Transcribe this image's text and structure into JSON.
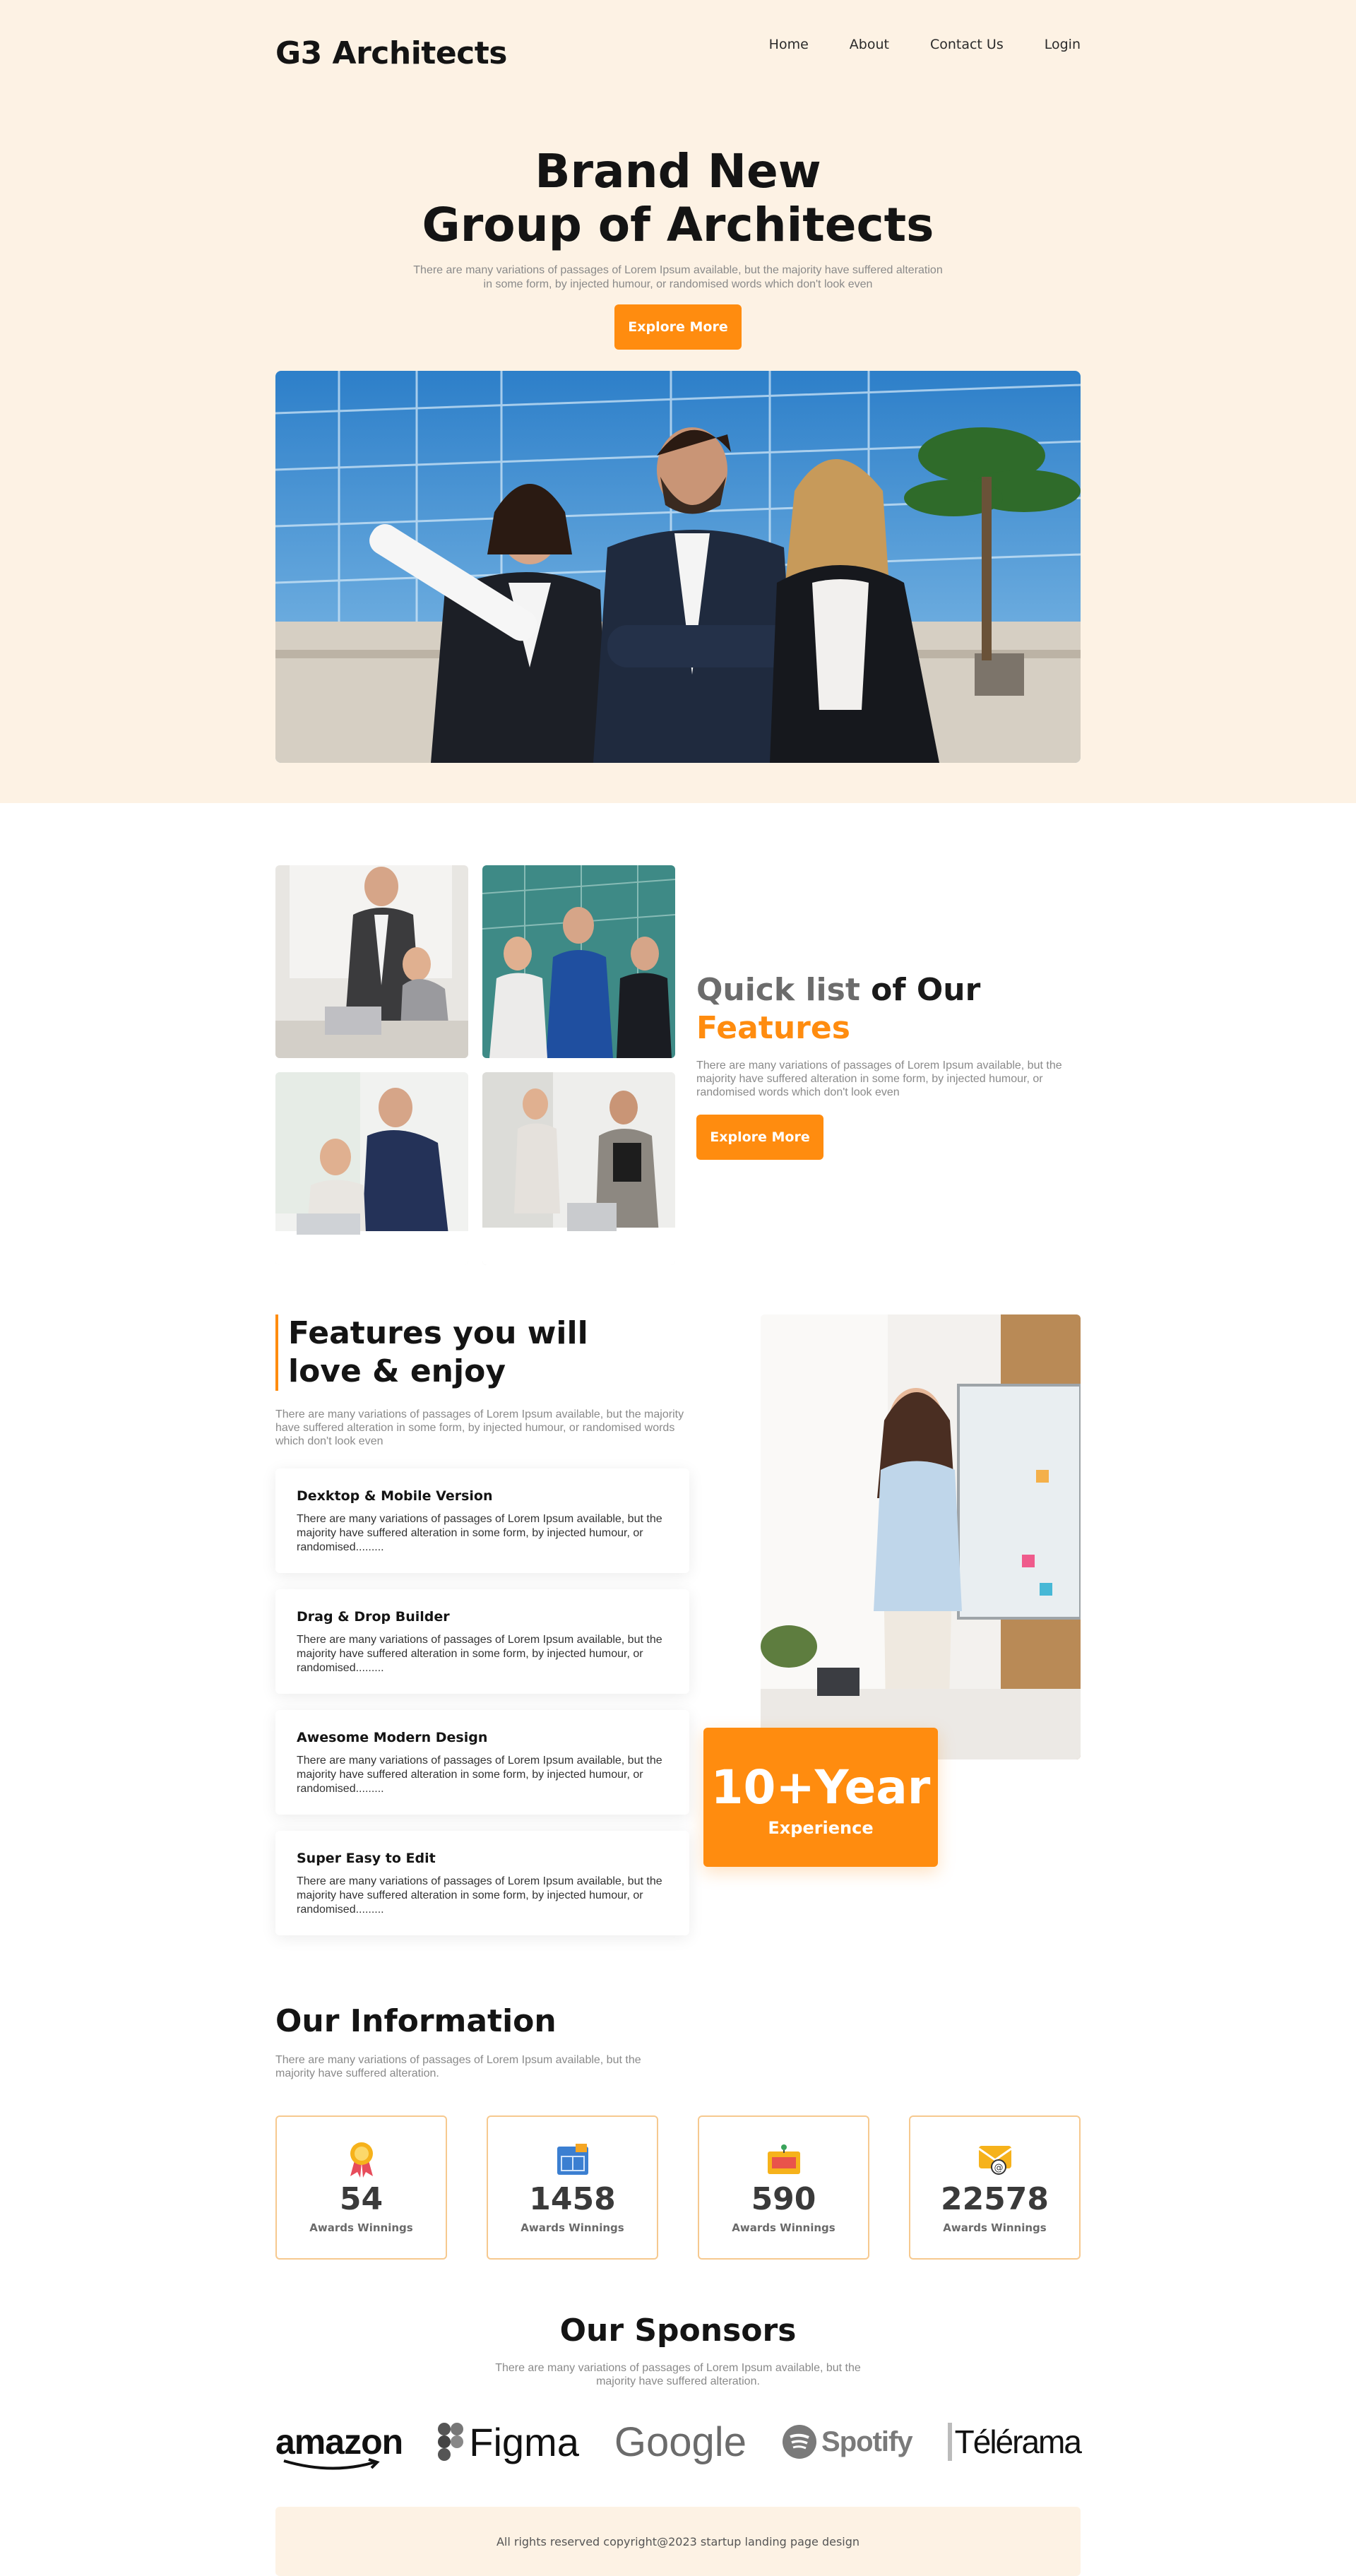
{
  "nav": {
    "logo": "G3 Architects",
    "items": [
      "Home",
      "About",
      "Contact Us",
      "Login"
    ]
  },
  "hero": {
    "title_line1": "Brand New",
    "title_line2": "Group of Architects",
    "subtitle": "There are many variations of passages of Lorem Ipsum available, but the majority have suffered alteration in some form, by injected humour, or randomised words which don't look even",
    "button": "Explore More"
  },
  "quick": {
    "title_gray": "Quick list",
    "title_dark": " of Our",
    "title_orange": "Features",
    "subtitle": "There are many variations of passages of Lorem Ipsum available, but the majority have suffered alteration in some form, by injected humour, or randomised words which don't look even",
    "button": "Explore More"
  },
  "features": {
    "title_line1": "Features you will",
    "title_line2": "love & enjoy",
    "subtitle": "There are many variations of passages of Lorem Ipsum available, but the majority have suffered alteration in some form, by injected humour, or randomised words which don't look even",
    "cards": [
      {
        "title": "Dexktop & Mobile Version",
        "text": "There are many variations of passages of Lorem Ipsum available, but the majority have suffered alteration in some form, by injected humour, or randomised........."
      },
      {
        "title": "Drag & Drop Builder",
        "text": "There are many variations of passages of Lorem Ipsum available, but the majority have suffered alteration in some form, by injected humour, or randomised........."
      },
      {
        "title": "Awesome Modern Design",
        "text": "There are many variations of passages of Lorem Ipsum available, but the majority have suffered alteration in some form, by injected humour, or randomised........."
      },
      {
        "title": "Super Easy to Edit",
        "text": "There are many variations of passages of Lorem Ipsum available, but the majority have suffered alteration in some form, by injected humour, or randomised........."
      }
    ],
    "experience_big": "10+Year",
    "experience_small": "Experience"
  },
  "info": {
    "title": "Our Information",
    "subtitle": "There are many variations of passages of Lorem Ipsum available, but the majority have suffered alteration.",
    "stats": [
      {
        "icon": "award-ribbon-icon",
        "value": "54",
        "label": "Awards Winnings"
      },
      {
        "icon": "blueprint-icon",
        "value": "1458",
        "label": "Awards Winnings"
      },
      {
        "icon": "certificate-icon",
        "value": "590",
        "label": "Awards Winnings"
      },
      {
        "icon": "email-icon",
        "value": "22578",
        "label": "Awards Winnings"
      }
    ]
  },
  "sponsors": {
    "title": "Our Sponsors",
    "subtitle": "There are many variations of passages of Lorem Ipsum available, but the majority have suffered alteration.",
    "logos": [
      "amazon",
      "Figma",
      "Google",
      "Spotify",
      "Télérama"
    ]
  },
  "footer": {
    "text": "All rights reserved copyright@2023 startup landing page design"
  },
  "colors": {
    "accent": "#ff8c0f",
    "hero_bg": "#fdf2e4",
    "border": "#f6c98f"
  }
}
